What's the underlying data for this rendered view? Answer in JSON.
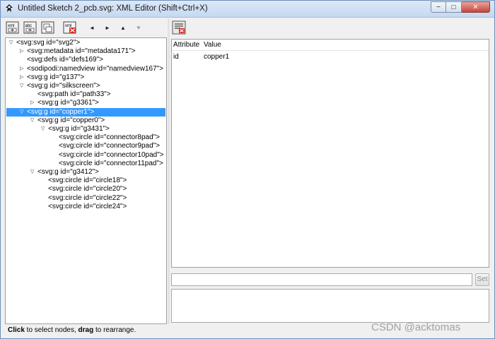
{
  "window": {
    "title": "Untitled Sketch 2_pcb.svg: XML Editor (Shift+Ctrl+X)",
    "minimize_glyph": "−",
    "maximize_glyph": "□",
    "close_glyph": "✕"
  },
  "toolbar": {
    "buttons": [
      {
        "name": "new-element-node-icon",
        "label": "xml"
      },
      {
        "name": "new-text-node-icon",
        "label": "abc"
      },
      {
        "name": "duplicate-node-icon",
        "label": ""
      },
      {
        "name": "delete-node-icon",
        "label": "xml"
      }
    ],
    "arrows": [
      {
        "name": "unindent-arrow-icon",
        "glyph": "◄"
      },
      {
        "name": "indent-arrow-icon",
        "glyph": "►"
      },
      {
        "name": "raise-node-arrow-icon",
        "glyph": "▲"
      },
      {
        "name": "lower-node-arrow-icon",
        "glyph": "▼"
      }
    ]
  },
  "tree": {
    "nodes": [
      {
        "text": "<svg:svg id=\"svg2\">",
        "depth": 0,
        "expander": "open"
      },
      {
        "text": "<svg:metadata id=\"metadata171\">",
        "depth": 1,
        "expander": "closed"
      },
      {
        "text": "<svg:defs id=\"defs169\">",
        "depth": 1,
        "expander": "none"
      },
      {
        "text": "<sodipodi:namedview id=\"namedview167\">",
        "depth": 1,
        "expander": "closed"
      },
      {
        "text": "<svg:g id=\"g137\">",
        "depth": 1,
        "expander": "closed"
      },
      {
        "text": "<svg:g id=\"silkscreen\">",
        "depth": 1,
        "expander": "open"
      },
      {
        "text": "<svg:path id=\"path33\">",
        "depth": 2,
        "expander": "none"
      },
      {
        "text": "<svg:g id=\"g3361\">",
        "depth": 2,
        "expander": "closed"
      },
      {
        "text": "<svg:g id=\"copper1\">",
        "depth": 1,
        "expander": "open",
        "selected": true
      },
      {
        "text": "<svg:g id=\"copper0\">",
        "depth": 2,
        "expander": "open"
      },
      {
        "text": "<svg:g id=\"g3431\">",
        "depth": 3,
        "expander": "open"
      },
      {
        "text": "<svg:circle id=\"connector8pad\">",
        "depth": 4,
        "expander": "none"
      },
      {
        "text": "<svg:circle id=\"connector9pad\">",
        "depth": 4,
        "expander": "none"
      },
      {
        "text": "<svg:circle id=\"connector10pad\">",
        "depth": 4,
        "expander": "none"
      },
      {
        "text": "<svg:circle id=\"connector11pad\">",
        "depth": 4,
        "expander": "none"
      },
      {
        "text": "<svg:g id=\"g3412\">",
        "depth": 2,
        "expander": "open"
      },
      {
        "text": "<svg:circle id=\"circle18\">",
        "depth": 3,
        "expander": "none"
      },
      {
        "text": "<svg:circle id=\"circle20\">",
        "depth": 3,
        "expander": "none"
      },
      {
        "text": "<svg:circle id=\"circle22\">",
        "depth": 3,
        "expander": "none"
      },
      {
        "text": "<svg:circle id=\"circle24\">",
        "depth": 3,
        "expander": "none"
      }
    ]
  },
  "status": {
    "click_word": "Click",
    "middle": " to select nodes, ",
    "drag_word": "drag",
    "end": " to rearrange."
  },
  "attributes": {
    "headers": {
      "attribute": "Attribute",
      "value": "Value"
    },
    "rows": [
      {
        "attribute": "id",
        "value": "copper1"
      }
    ]
  },
  "editor": {
    "value_input": "",
    "set_label": "Set",
    "value_area": ""
  },
  "watermark": "CSDN @acktomas"
}
